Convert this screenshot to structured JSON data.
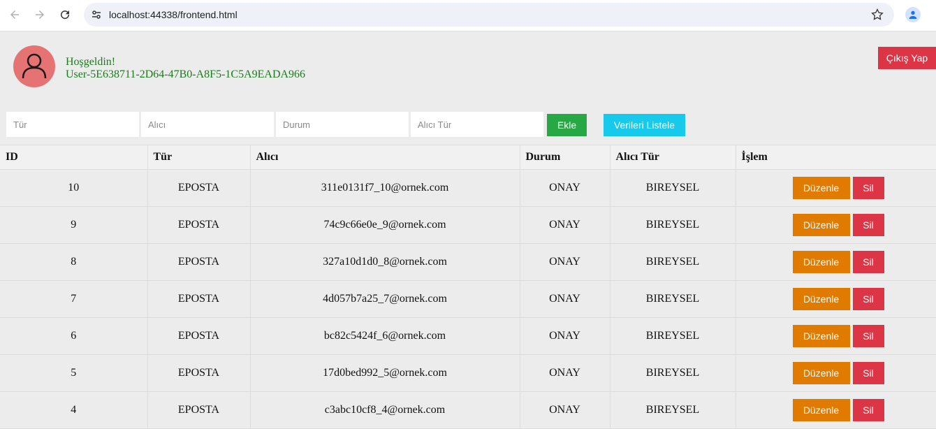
{
  "browser": {
    "url": "localhost:44338/frontend.html"
  },
  "header": {
    "welcome": "Hoşgeldin!",
    "user": "User-5E638711-2D64-47B0-A8F5-1C5A9EADA966",
    "logout_label": "Çıkış Yap"
  },
  "form": {
    "tur_placeholder": "Tür",
    "alici_placeholder": "Alıcı",
    "durum_placeholder": "Durum",
    "alici_tur_placeholder": "Alıcı Tür",
    "add_label": "Ekle",
    "list_label": "Verileri Listele"
  },
  "table": {
    "headers": [
      "ID",
      "Tür",
      "Alıcı",
      "Durum",
      "Alıcı Tür",
      "İşlem"
    ],
    "edit_label": "Düzenle",
    "delete_label": "Sil",
    "rows": [
      {
        "id": "10",
        "tur": "EPOSTA",
        "alici": "311e0131f7_10@ornek.com",
        "durum": "ONAY",
        "alici_tur": "BIREYSEL"
      },
      {
        "id": "9",
        "tur": "EPOSTA",
        "alici": "74c9c66e0e_9@ornek.com",
        "durum": "ONAY",
        "alici_tur": "BIREYSEL"
      },
      {
        "id": "8",
        "tur": "EPOSTA",
        "alici": "327a10d1d0_8@ornek.com",
        "durum": "ONAY",
        "alici_tur": "BIREYSEL"
      },
      {
        "id": "7",
        "tur": "EPOSTA",
        "alici": "4d057b7a25_7@ornek.com",
        "durum": "ONAY",
        "alici_tur": "BIREYSEL"
      },
      {
        "id": "6",
        "tur": "EPOSTA",
        "alici": "bc82c5424f_6@ornek.com",
        "durum": "ONAY",
        "alici_tur": "BIREYSEL"
      },
      {
        "id": "5",
        "tur": "EPOSTA",
        "alici": "17d0bed992_5@ornek.com",
        "durum": "ONAY",
        "alici_tur": "BIREYSEL"
      },
      {
        "id": "4",
        "tur": "EPOSTA",
        "alici": "c3abc10cf8_4@ornek.com",
        "durum": "ONAY",
        "alici_tur": "BIREYSEL"
      }
    ]
  }
}
